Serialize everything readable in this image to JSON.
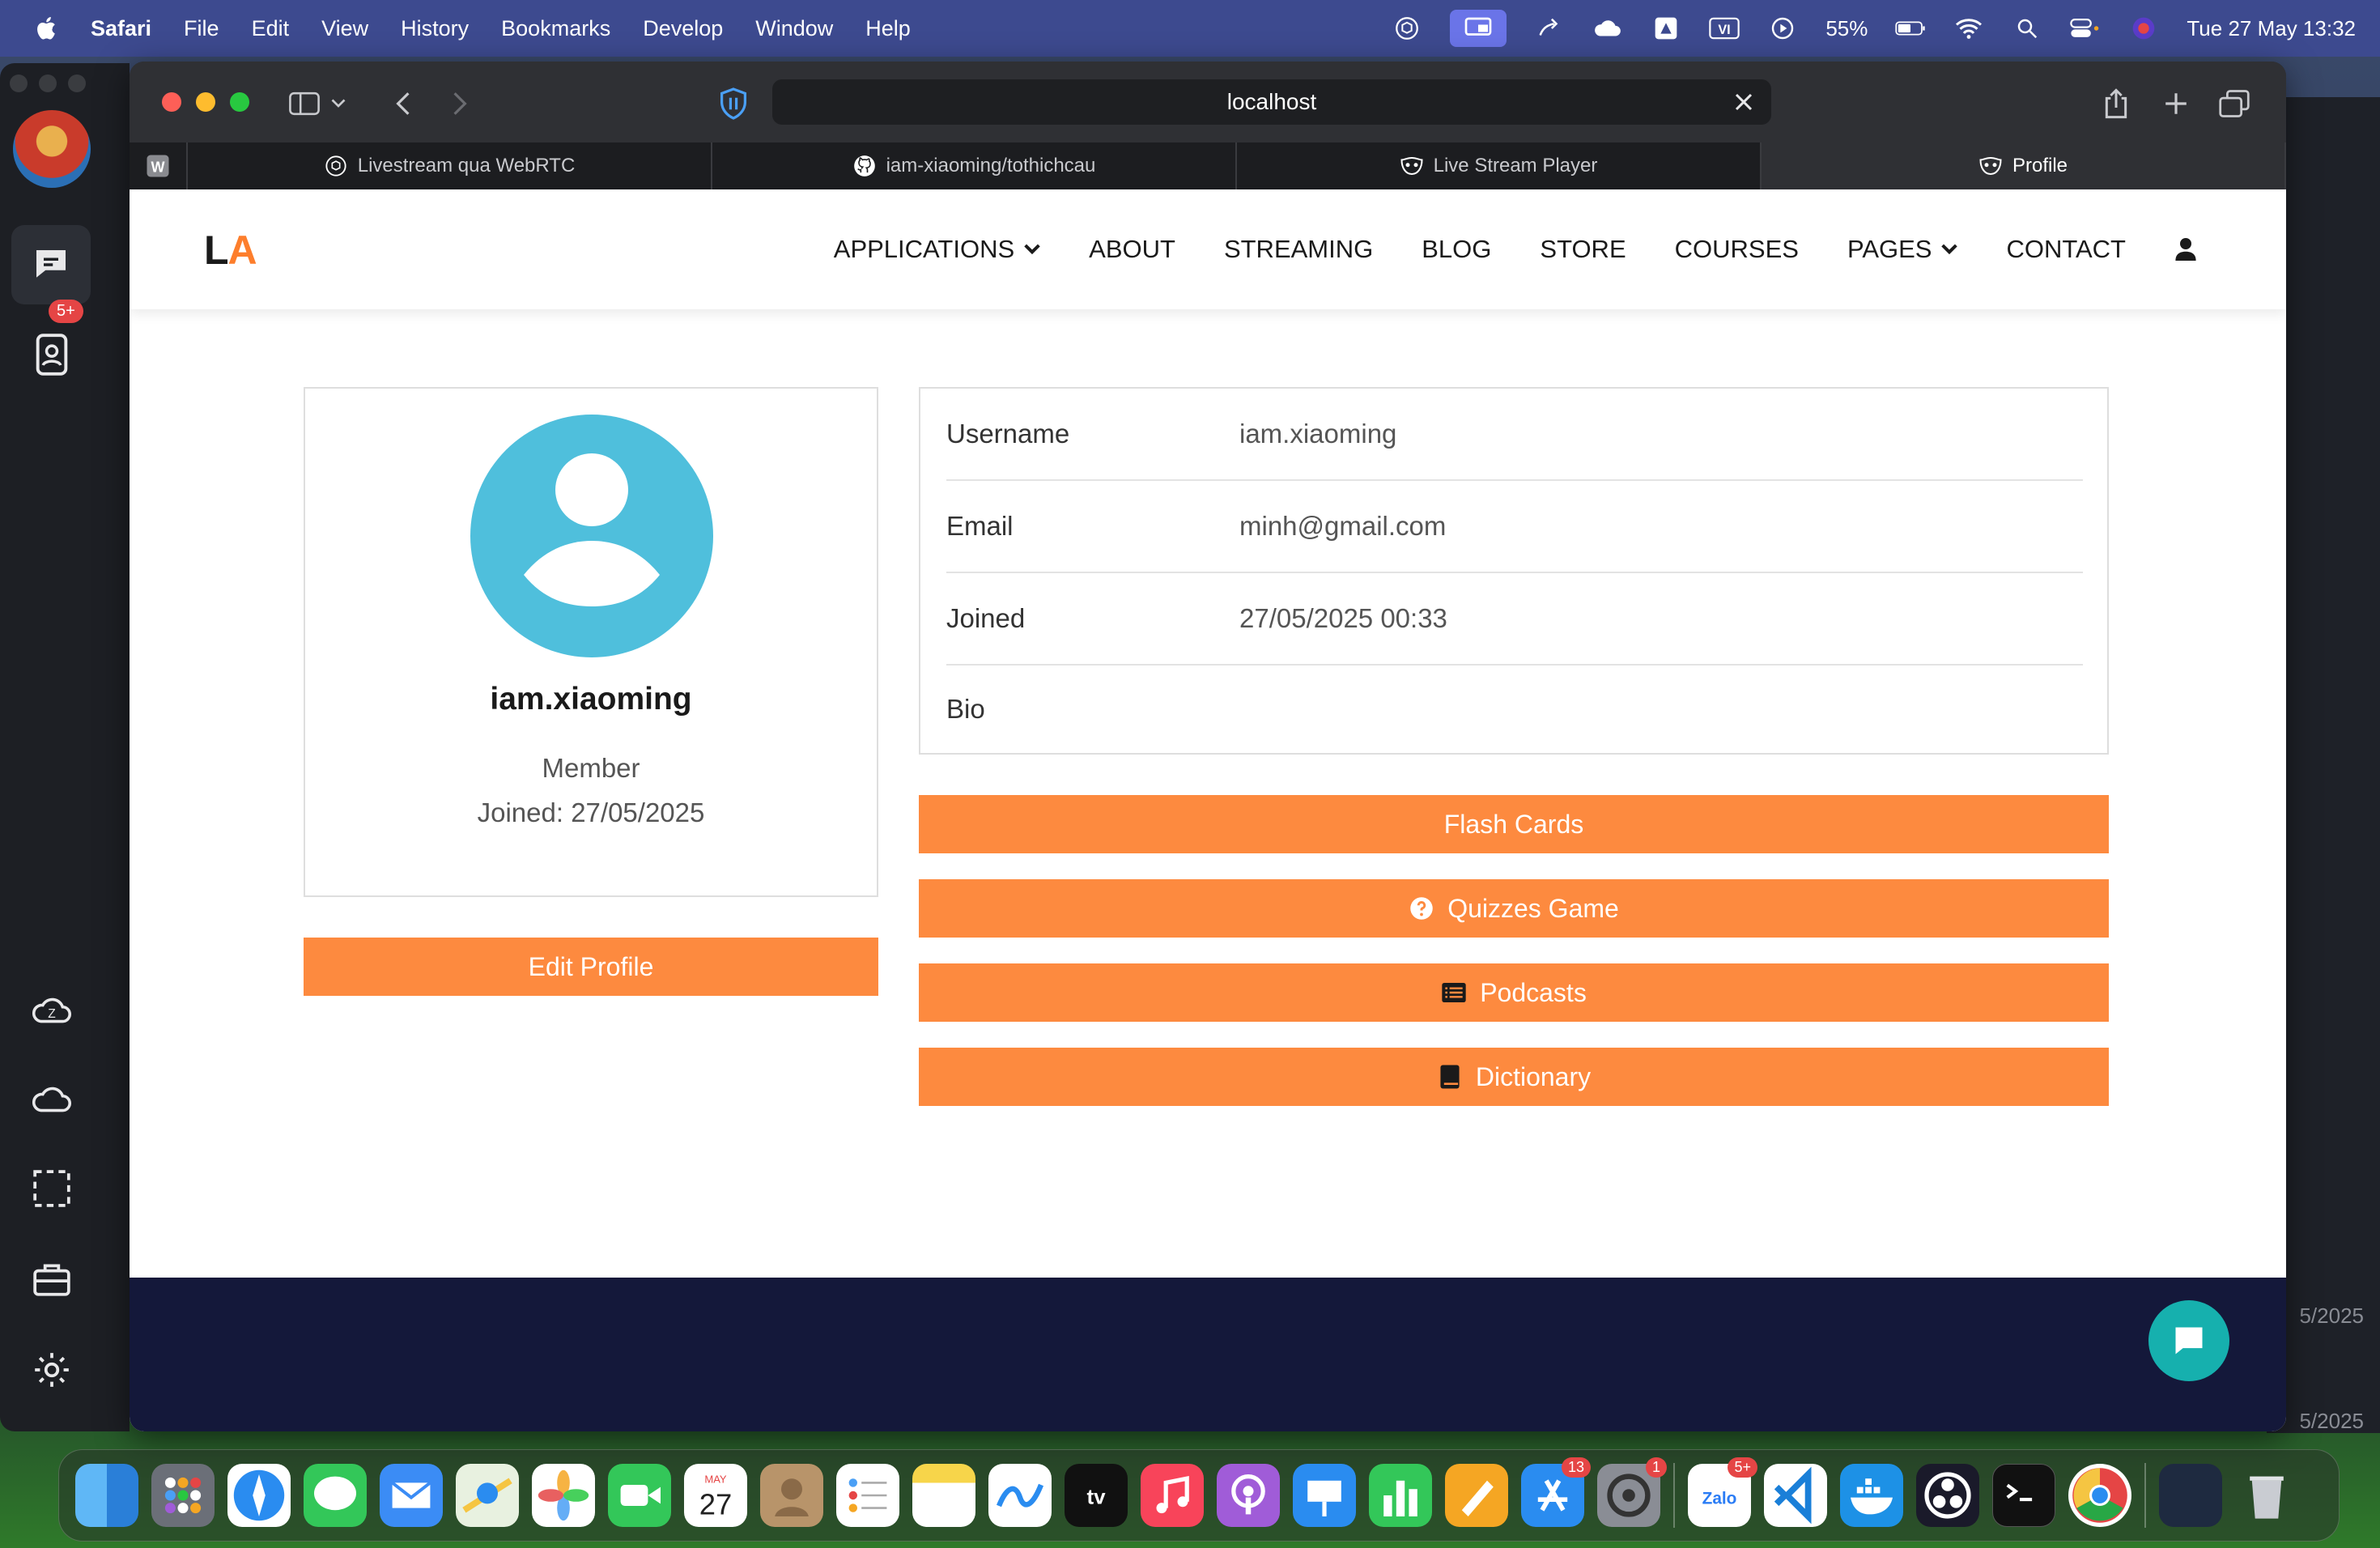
{
  "menubar": {
    "app": "Safari",
    "items": [
      "File",
      "Edit",
      "View",
      "History",
      "Bookmarks",
      "Develop",
      "Window",
      "Help"
    ],
    "battery": "55%",
    "datetime": "Tue 27 May  13:32"
  },
  "left_app": {
    "badge": "5+"
  },
  "background_window": {
    "date1": "5/2025",
    "date2": "5/2025"
  },
  "browser": {
    "url": "localhost",
    "tabs": [
      {
        "label": "W",
        "icon": "w-icon"
      },
      {
        "label": "Livestream qua WebRTC",
        "icon": "openai-icon"
      },
      {
        "label": "iam-xiaoming/tothichcau",
        "icon": "github-icon"
      },
      {
        "label": "Live Stream Player",
        "icon": "mask-icon"
      },
      {
        "label": "Profile",
        "icon": "mask-icon"
      }
    ]
  },
  "site": {
    "logo_l": "L",
    "logo_a": "A",
    "nav": [
      "APPLICATIONS",
      "ABOUT",
      "STREAMING",
      "BLOG",
      "STORE",
      "COURSES",
      "PAGES",
      "CONTACT"
    ]
  },
  "profile": {
    "username": "iam.xiaoming",
    "role": "Member",
    "joined_short": "Joined: 27/05/2025",
    "edit_label": "Edit Profile",
    "fields": [
      {
        "key": "Username",
        "value": "iam.xiaoming"
      },
      {
        "key": "Email",
        "value": "minh@gmail.com"
      },
      {
        "key": "Joined",
        "value": "27/05/2025 00:33"
      },
      {
        "key": "Bio",
        "value": ""
      }
    ]
  },
  "actions": [
    {
      "label": "Flash Cards",
      "icon": ""
    },
    {
      "label": "Quizzes Game",
      "icon": "question-circle-icon"
    },
    {
      "label": "Podcasts",
      "icon": "list-icon"
    },
    {
      "label": "Dictionary",
      "icon": "book-icon"
    }
  ],
  "dock": {
    "calendar_month": "MAY",
    "calendar_day": "27",
    "appstore_badge": "13",
    "settings_badge": "1",
    "zalo_label": "Zalo",
    "zalo_badge": "5+"
  }
}
